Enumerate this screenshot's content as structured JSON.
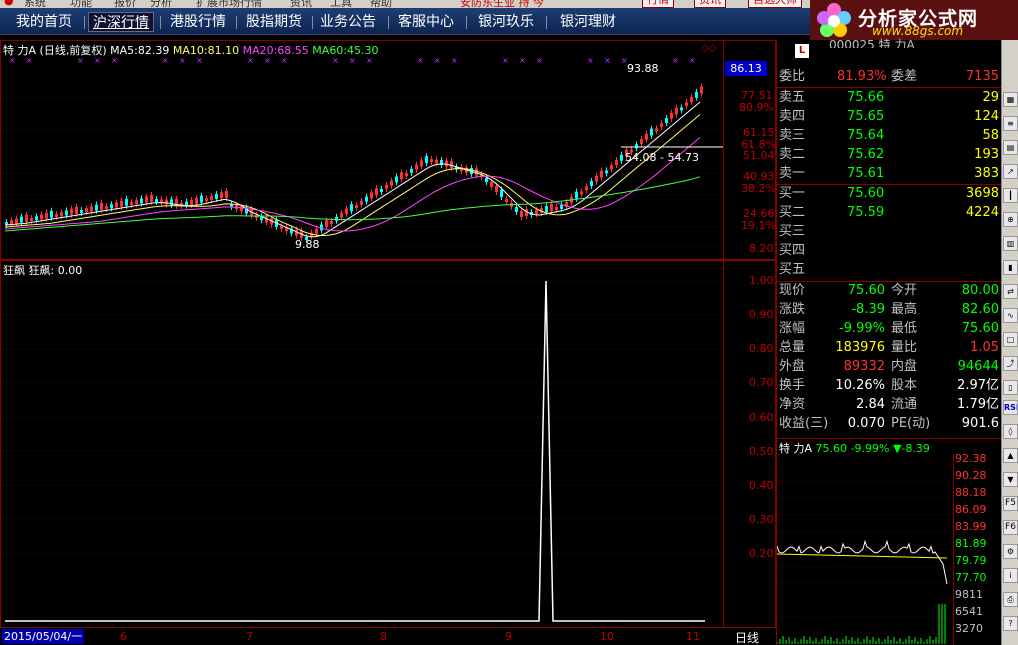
{
  "topstrip": {
    "items": [
      "系统",
      "功能",
      "报价",
      "分析",
      "扩展市场行情",
      "资讯",
      "工具",
      "帮助"
    ],
    "notice": "安防东生业  持  今",
    "buttons": [
      "行情",
      "资讯",
      "自选大师"
    ]
  },
  "nav": {
    "items": [
      "我的首页",
      "沪深行情",
      "港股行情",
      "股指期货",
      "业务公告",
      "客服中心",
      "银河玖乐",
      "银河理财"
    ],
    "active_index": 1
  },
  "logo": {
    "title": "分析家公式网",
    "url": "www.88gs.com"
  },
  "main_chart": {
    "stock_label": "特 力A",
    "period_label": "(日线,前复权)",
    "ma": [
      {
        "label": "MA5:",
        "value": "82.39",
        "color": "#ffffff"
      },
      {
        "label": "MA10:",
        "value": "81.10",
        "color": "#ffff66"
      },
      {
        "label": "MA20:",
        "value": "68.55",
        "color": "#ff44ff"
      },
      {
        "label": "MA60:",
        "value": "45.30",
        "color": "#44ff44"
      }
    ],
    "y_ticks": [
      "77.51",
      "80.9%",
      "61.15",
      "61.8%",
      "51.04",
      "40.93",
      "38.2%",
      "24.66",
      "19.1%",
      "8.20"
    ],
    "price_box": "86.13",
    "high_label": "93.88",
    "low_label": "9.88",
    "range_label": "54.08 - 54.73"
  },
  "indicator": {
    "title": "狂飙",
    "value_label": "狂飙: 0.00",
    "y_ticks": [
      "1.00",
      "0.90",
      "0.80",
      "0.70",
      "0.60",
      "0.50",
      "0.40",
      "0.30",
      "0.20"
    ]
  },
  "x_axis": {
    "start_date": "2015/05/04/一",
    "months": [
      "6",
      "7",
      "8",
      "9",
      "10",
      "11"
    ],
    "period_button": "日线"
  },
  "quote": {
    "code": "000025 特 力A",
    "weibi": {
      "label": "委比",
      "value": "81.93%",
      "label2": "委差",
      "value2": "7135"
    },
    "sell": [
      {
        "label": "卖五",
        "price": "75.66",
        "vol": "29"
      },
      {
        "label": "卖四",
        "price": "75.65",
        "vol": "124"
      },
      {
        "label": "卖三",
        "price": "75.64",
        "vol": "58"
      },
      {
        "label": "卖二",
        "price": "75.62",
        "vol": "193"
      },
      {
        "label": "卖一",
        "price": "75.61",
        "vol": "383"
      }
    ],
    "buy": [
      {
        "label": "买一",
        "price": "75.60",
        "vol": "3698"
      },
      {
        "label": "买二",
        "price": "75.59",
        "vol": "4224"
      },
      {
        "label": "买三",
        "price": "",
        "vol": ""
      },
      {
        "label": "买四",
        "price": "",
        "vol": ""
      },
      {
        "label": "买五",
        "price": "",
        "vol": ""
      }
    ],
    "stats": [
      {
        "l1": "现价",
        "v1": "75.60",
        "c1": "#00ff00",
        "l2": "今开",
        "v2": "80.00",
        "c2": "#00ff00"
      },
      {
        "l1": "涨跌",
        "v1": "-8.39",
        "c1": "#00ff00",
        "l2": "最高",
        "v2": "82.60",
        "c2": "#00ff00"
      },
      {
        "l1": "涨幅",
        "v1": "-9.99%",
        "c1": "#00ff00",
        "l2": "最低",
        "v2": "75.60",
        "c2": "#00ff00"
      },
      {
        "l1": "总量",
        "v1": "183976",
        "c1": "#ffff00",
        "l2": "量比",
        "v2": "1.05",
        "c2": "#ff3030"
      },
      {
        "l1": "外盘",
        "v1": "89332",
        "c1": "#ff3030",
        "l2": "内盘",
        "v2": "94644",
        "c2": "#00ff00"
      },
      {
        "l1": "换手",
        "v1": "10.26%",
        "c1": "#ffffff",
        "l2": "股本",
        "v2": "2.97亿",
        "c2": "#ffffff"
      },
      {
        "l1": "净资",
        "v1": "2.84",
        "c1": "#ffffff",
        "l2": "流通",
        "v2": "1.79亿",
        "c2": "#ffffff"
      },
      {
        "l1": "收益(三)",
        "v1": "0.070",
        "c1": "#ffffff",
        "l2": "PE(动)",
        "v2": "901.6",
        "c2": "#ffffff"
      }
    ],
    "mini": {
      "name": "特 力A",
      "price": "75.60",
      "pct": "-9.99%",
      "change": "▼-8.39",
      "y_ticks": [
        "92.38",
        "90.28",
        "88.18",
        "86.09",
        "83.99",
        "81.89",
        "79.79",
        "77.70",
        "9811",
        "6541",
        "3270"
      ]
    }
  },
  "toolbar_icons": [
    "RSI",
    "F5",
    "F6"
  ],
  "colors": {
    "up": "#ff3030",
    "down": "#00ffff",
    "frame": "#8a0000",
    "tick": "#c00000"
  }
}
